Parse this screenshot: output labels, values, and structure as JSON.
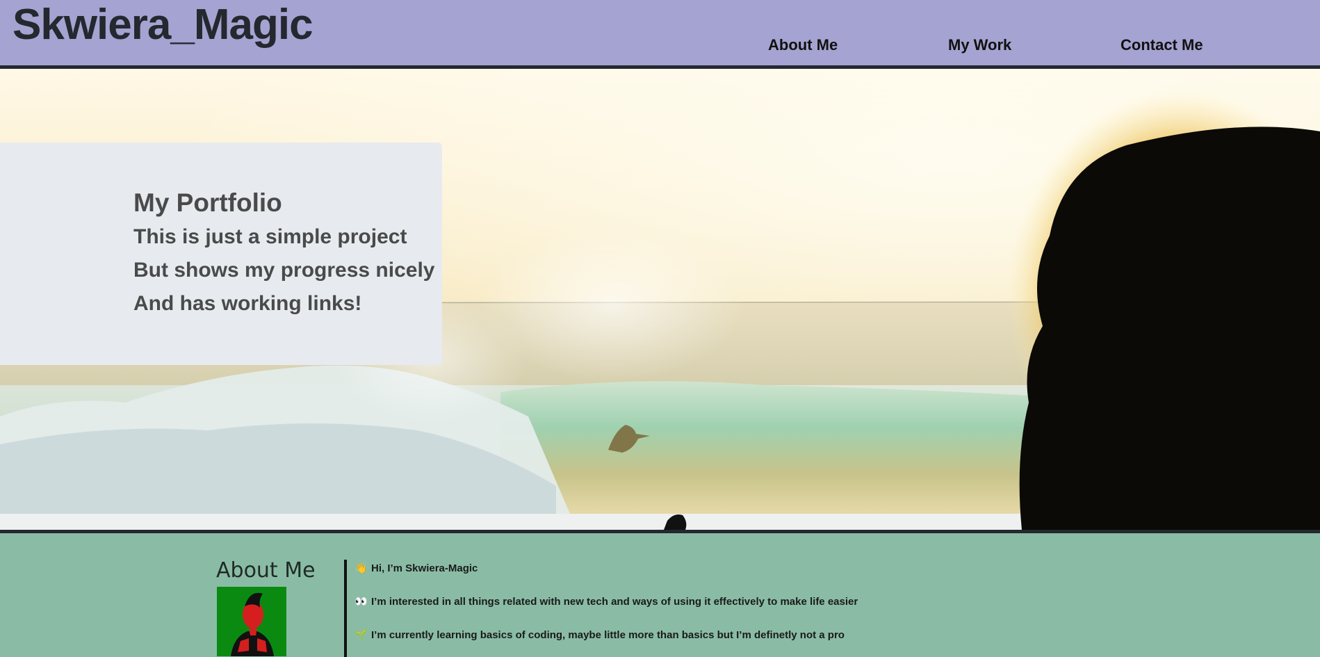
{
  "header": {
    "title": "Skwiera_Magic",
    "nav": [
      {
        "label": "About Me"
      },
      {
        "label": "My Work"
      },
      {
        "label": "Contact Me"
      }
    ]
  },
  "hero": {
    "heading": "My Portfolio",
    "lines": [
      "This is just a simple project",
      "But shows my progress nicely",
      "And has working links!"
    ]
  },
  "about": {
    "title": "About Me",
    "items": [
      {
        "icon": "waving-hand-icon",
        "glyph": "👋",
        "text": "Hi, I’m Skwiera-Magic"
      },
      {
        "icon": "eyes-icon",
        "glyph": "👀",
        "text": "I’m interested in all things related with new tech and ways of using it effectively to make life easier"
      },
      {
        "icon": "seedling-icon",
        "glyph": "🌱",
        "text": "I’m currently learning basics of coding, maybe little more than basics but I’m definetly not a pro"
      }
    ]
  },
  "colors": {
    "header_bg": "#a5a3d1",
    "about_bg": "#8abca5",
    "card_bg": "#e7ebef",
    "border": "#24282f"
  }
}
